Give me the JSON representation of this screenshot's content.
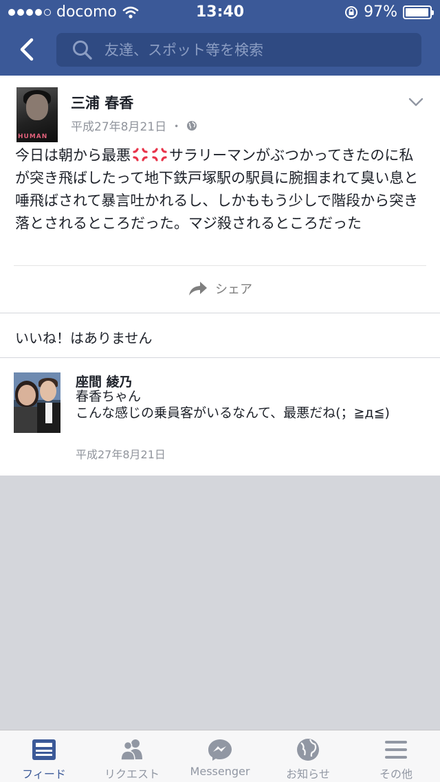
{
  "status_bar": {
    "carrier": "docomo",
    "time": "13:40",
    "battery": "97%",
    "battery_level": 0.97
  },
  "search": {
    "placeholder": "友達、スポット等を検索"
  },
  "post": {
    "author": "三浦 春香",
    "date": "平成27年8月21日",
    "separator": "・",
    "text_before_emoji": "今日は朝から最悪",
    "text_after_emoji": "サラリーマンがぶつかってきたのに私が突き飛ばしたって地下鉄戸塚駅の駅員に腕掴まれて臭い息と唾飛ばされて暴言吐かれるし、しかももう少しで階段から突き落とされるところだった。マジ殺されるところだった",
    "avatar_cover_text": "HUMAN",
    "share_label": "シェア"
  },
  "likes": {
    "text": "いいね！はありません"
  },
  "comment": {
    "author": "座間 綾乃",
    "line1": "春香ちゃん",
    "line2": "こんな感じの乗員客がいるなんて、最悪だね(；≧д≦)",
    "date": "平成27年8月21日"
  },
  "tabbar": {
    "tabs": [
      {
        "label": "フィード",
        "icon": "feed-icon",
        "active": true
      },
      {
        "label": "リクエスト",
        "icon": "friend-requests-icon",
        "active": false
      },
      {
        "label": "Messenger",
        "icon": "messenger-icon",
        "active": false
      },
      {
        "label": "お知らせ",
        "icon": "notifications-globe-icon",
        "active": false
      },
      {
        "label": "その他",
        "icon": "menu-icon",
        "active": false
      }
    ]
  },
  "colors": {
    "header": "#3b5998",
    "active_tab": "#3b5998",
    "inactive_tab": "#9197a3",
    "anger_emoji": "#e8344a"
  }
}
